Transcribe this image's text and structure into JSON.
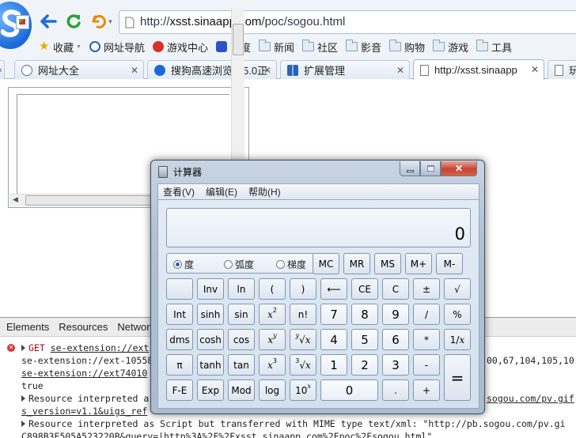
{
  "browser": {
    "url_prefix": "http://",
    "url_host": "xsst.sinaapp.com",
    "url_path": "/poc/sogou.html",
    "bookmarks": [
      {
        "label": "收藏",
        "icon": "star-icon"
      },
      {
        "label": "网址导航",
        "icon": "globe-icon"
      },
      {
        "label": "游戏中心",
        "icon": "game-icon"
      },
      {
        "label": "百度",
        "icon": "baidu-paw-icon"
      },
      {
        "label": "新闻",
        "icon": "folder-icon"
      },
      {
        "label": "社区",
        "icon": "folder-icon"
      },
      {
        "label": "影音",
        "icon": "folder-icon"
      },
      {
        "label": "购物",
        "icon": "folder-icon"
      },
      {
        "label": "游戏",
        "icon": "folder-icon"
      },
      {
        "label": "工具",
        "icon": "folder-icon"
      }
    ],
    "tabs": [
      {
        "label": "网址大全",
        "icon": "globe-icon"
      },
      {
        "label": "搜狗高速浏览器5.0正",
        "icon": "sogou-icon"
      },
      {
        "label": "扩展管理",
        "icon": "extension-icon"
      },
      {
        "label": "http://xsst.sinaapp",
        "icon": "page-icon"
      },
      {
        "label": "玩",
        "icon": "page-icon"
      }
    ]
  },
  "devtools": {
    "tabs": [
      "Elements",
      "Resources",
      "Network"
    ],
    "lines": [
      {
        "method": "GET",
        "text": "se-extension://ext"
      },
      {
        "text": "se-extension://ext-10558",
        "right": "00,67,104,105,10"
      },
      {
        "text": "se-extension://ext74010"
      },
      {
        "text": "true"
      },
      {
        "text": "Resource interpreted a",
        "right": "sogou.com/pv.gif"
      },
      {
        "text": "s_version=v1.1&uigs_ref"
      },
      {
        "text": "Resource interpreted as Script but transferred with MIME type text/xml: \"http://pb.sogou.com/pv.gi"
      },
      {
        "text": "C898B3E505A523220B&query=|http%3A%2F%2Fxsst.sinaapp.com%2Fpoc%2Fsogou.html\"."
      }
    ]
  },
  "calculator": {
    "title": "计算器",
    "menu": [
      "查看(V)",
      "编辑(E)",
      "帮助(H)"
    ],
    "display": "0",
    "angle_modes": [
      "度",
      "弧度",
      "梯度"
    ],
    "selected_mode": "度",
    "keys": {
      "mc": "MC",
      "mr": "MR",
      "ms": "MS",
      "mplus": "M+",
      "mminus": "M-",
      "inv": "Inv",
      "ln": "ln",
      "lparen": "(",
      "rparen": ")",
      "back": "⟵",
      "ce": "CE",
      "c": "C",
      "pm": "±",
      "sqrt": "√",
      "int": "Int",
      "sinh": "sinh",
      "sin": "sin",
      "n_fact": "n!",
      "n7": "7",
      "n8": "8",
      "n9": "9",
      "div": "/",
      "pct": "%",
      "dms": "dms",
      "cosh": "cosh",
      "cos": "cos",
      "n4": "4",
      "n5": "5",
      "n6": "6",
      "mul": "*",
      "pi": "π",
      "tanh": "tanh",
      "tan": "tan",
      "n1": "1",
      "n2": "2",
      "n3": "3",
      "sub": "-",
      "eq": "=",
      "fe": "F-E",
      "exp": "Exp",
      "mod": "Mod",
      "log": "log",
      "n0": "0",
      "dot": ".",
      "add": "+"
    }
  }
}
